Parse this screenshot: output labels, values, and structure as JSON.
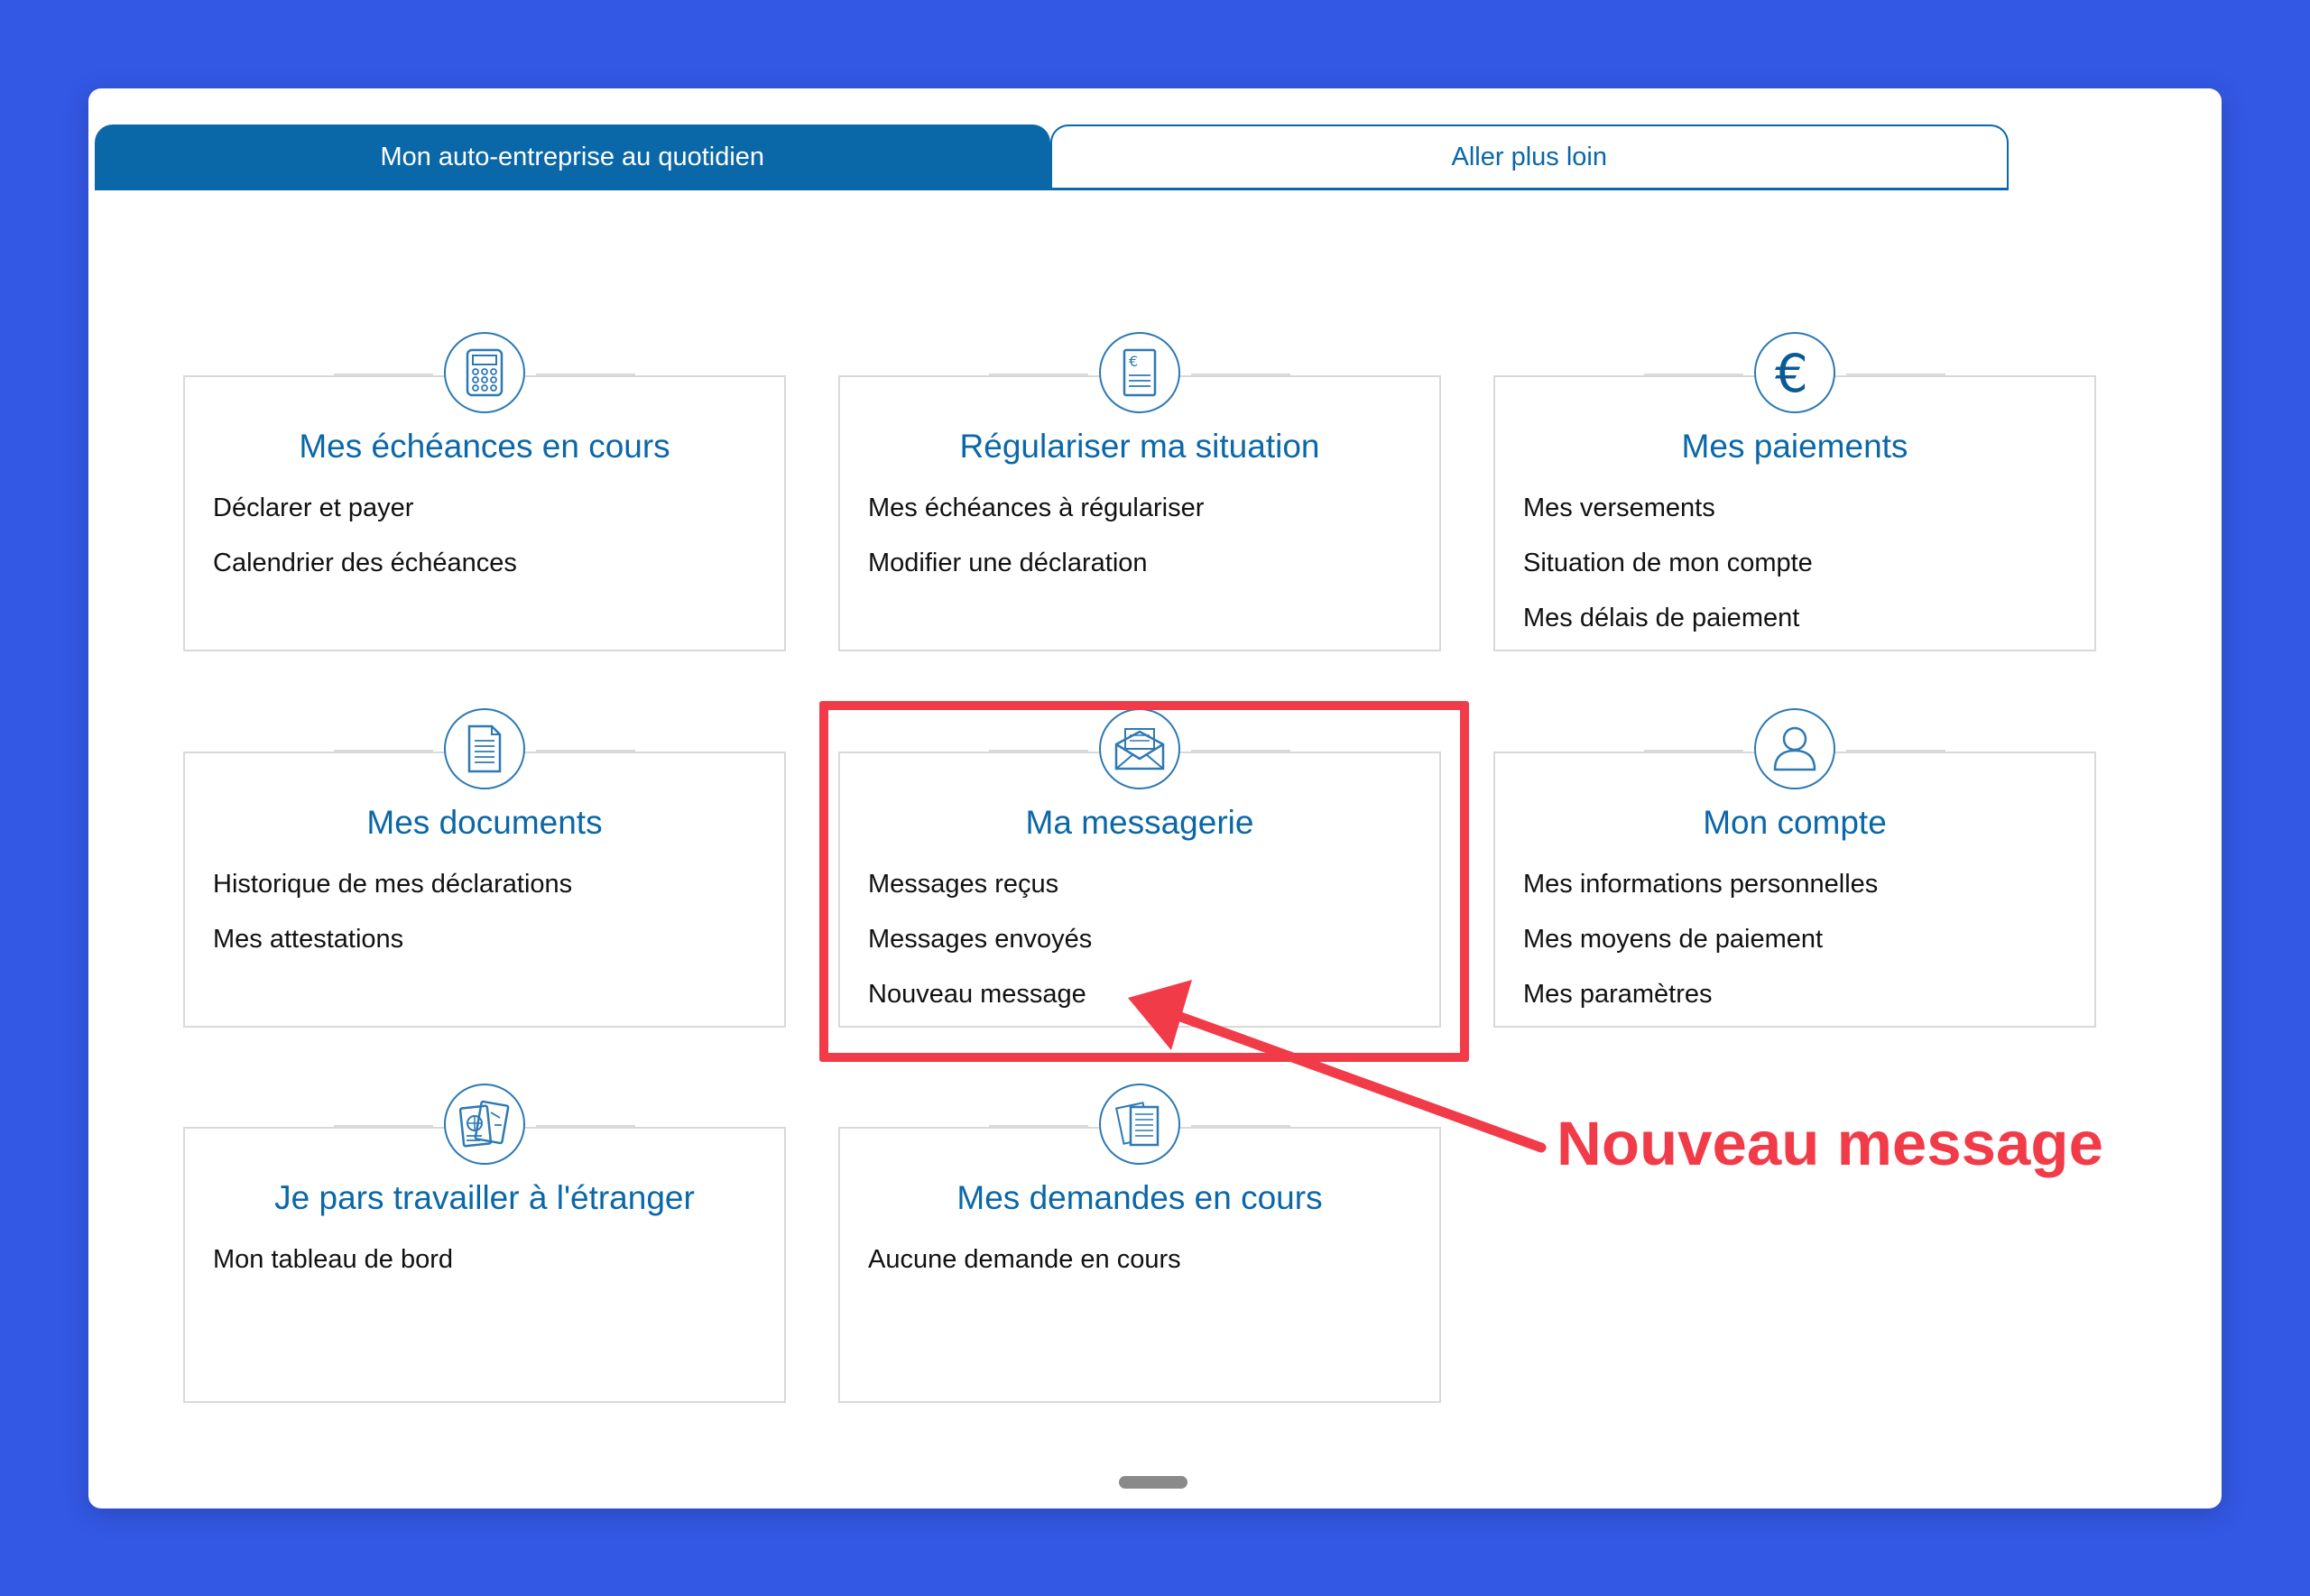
{
  "tabs": [
    {
      "label": "Mon auto-entreprise au quotidien",
      "active": true
    },
    {
      "label": "Aller plus loin",
      "active": false
    }
  ],
  "cards": [
    {
      "title": "Mes échéances en cours",
      "icon": "calculator-icon",
      "links": [
        "Déclarer et payer",
        "Calendrier des échéances"
      ]
    },
    {
      "title": "Régulariser ma situation",
      "icon": "euro-document-icon",
      "links": [
        "Mes échéances à régulariser",
        "Modifier une déclaration"
      ]
    },
    {
      "title": "Mes paiements",
      "icon": "euro-icon",
      "links": [
        "Mes versements",
        "Situation de mon compte",
        "Mes délais de paiement"
      ]
    },
    {
      "title": "Mes documents",
      "icon": "document-icon",
      "links": [
        "Historique de mes déclarations",
        "Mes attestations"
      ]
    },
    {
      "title": "Ma messagerie",
      "icon": "envelope-icon",
      "links": [
        "Messages reçus",
        "Messages envoyés",
        "Nouveau message"
      ]
    },
    {
      "title": "Mon compte",
      "icon": "user-icon",
      "links": [
        "Mes informations personnelles",
        "Mes moyens de paiement",
        "Mes paramètres"
      ]
    },
    {
      "title": "Je pars travailler à l'étranger",
      "icon": "passport-icon",
      "links": [
        "Mon tableau de bord"
      ]
    },
    {
      "title": "Mes demandes en cours",
      "icon": "requests-icon",
      "links": [
        "Aucune demande en cours"
      ]
    }
  ],
  "annotation": {
    "text": "Nouveau message"
  },
  "colors": {
    "accent": "#0a67a8",
    "highlight": "#f23b48",
    "background": "#3358e4"
  }
}
